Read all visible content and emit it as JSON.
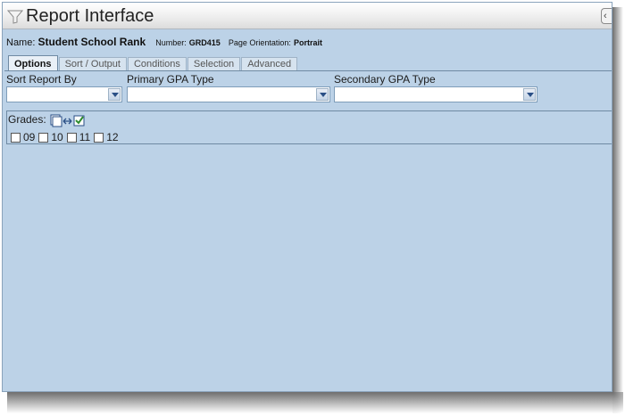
{
  "window": {
    "title": "Report Interface"
  },
  "header": {
    "name_label": "Name:",
    "name_value": "Student School Rank",
    "number_label": "Number:",
    "number_value": "GRD415",
    "orientation_label": "Page Orientation:",
    "orientation_value": "Portrait"
  },
  "tabs": [
    {
      "label": "Options",
      "active": true
    },
    {
      "label": "Sort / Output",
      "active": false
    },
    {
      "label": "Conditions",
      "active": false
    },
    {
      "label": "Selection",
      "active": false
    },
    {
      "label": "Advanced",
      "active": false
    }
  ],
  "fields": {
    "sort_report_by": {
      "label": "Sort Report By",
      "value": ""
    },
    "primary_gpa_type": {
      "label": "Primary GPA Type",
      "value": ""
    },
    "secondary_gpa_type": {
      "label": "Secondary GPA Type",
      "value": ""
    }
  },
  "grades": {
    "label": "Grades:",
    "options": [
      {
        "label": "09",
        "checked": false
      },
      {
        "label": "10",
        "checked": false
      },
      {
        "label": "11",
        "checked": false
      },
      {
        "label": "12",
        "checked": false
      }
    ]
  },
  "colors": {
    "panel_bg": "#bcd2e7",
    "border": "#6f8aa3",
    "active_tab": "#e9f0f7"
  },
  "icons": [
    "filter-icon",
    "collapse-icon",
    "dropdown-arrow-icon",
    "select-all-toggle-icon"
  ]
}
